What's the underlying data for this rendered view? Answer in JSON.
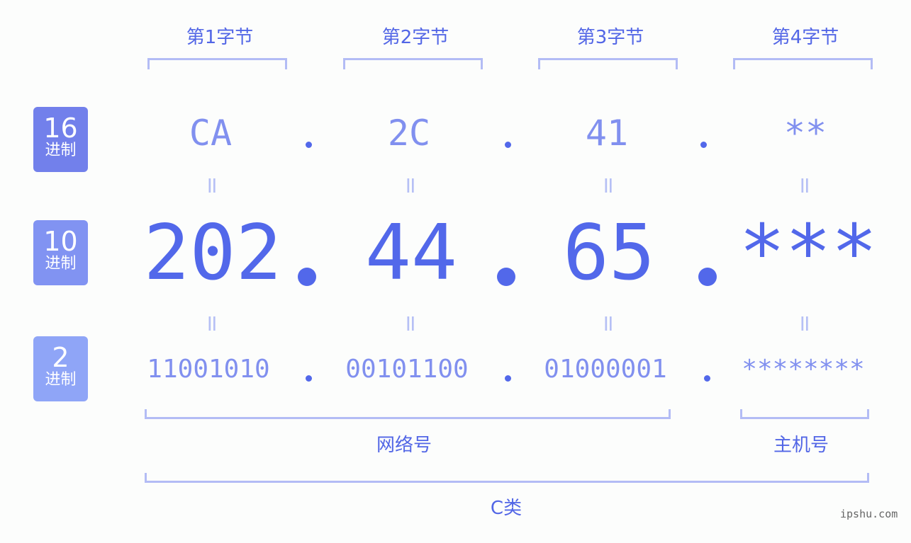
{
  "bytes": [
    {
      "label": "第1字节",
      "hex": "CA",
      "dec": "202",
      "bin": "11001010"
    },
    {
      "label": "第2字节",
      "hex": "2C",
      "dec": "44",
      "bin": "00101100"
    },
    {
      "label": "第3字节",
      "hex": "41",
      "dec": "65",
      "bin": "01000001"
    },
    {
      "label": "第4字节",
      "hex": "**",
      "dec": "***",
      "bin": "********"
    }
  ],
  "rows": {
    "hex": {
      "num": "16",
      "unit": "进制",
      "color": "#7280eb"
    },
    "dec": {
      "num": "10",
      "unit": "进制",
      "color": "#8193f2"
    },
    "bin": {
      "num": "2",
      "unit": "进制",
      "color": "#8fa5f7"
    }
  },
  "equals": "=",
  "groups": {
    "network": "网络号",
    "host": "主机号",
    "class": "C类"
  },
  "watermark": "ipshu.com"
}
